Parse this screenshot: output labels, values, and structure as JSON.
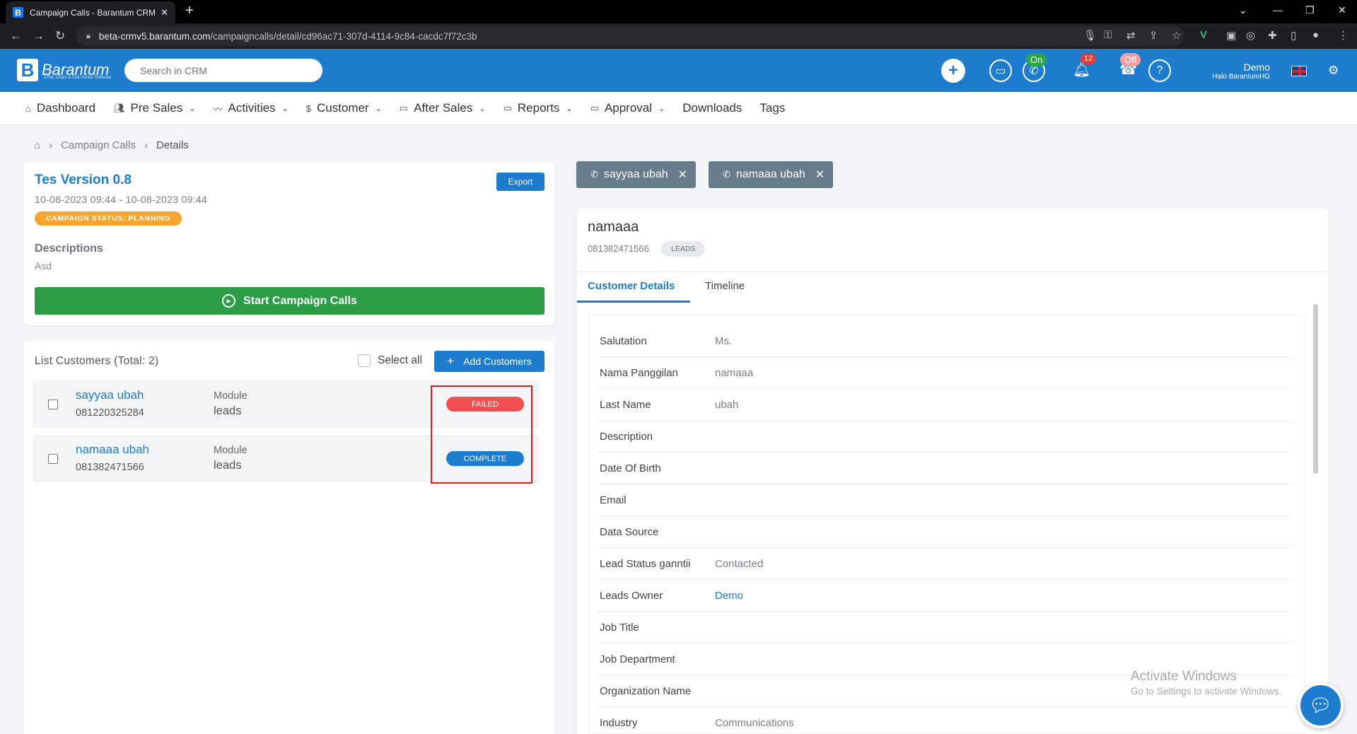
{
  "browser": {
    "tab_title": "Campaign Calls - Barantum CRM",
    "url_host": "beta-crmv5.barantum.com",
    "url_path": "/campaigncalls/detail/cd96ac71-307d-4114-9c84-cacdc7f72c3b"
  },
  "header": {
    "logo_name": "Barantum",
    "logo_tagline": "CRM, Chats & Call Center Software",
    "search_placeholder": "Search in CRM",
    "call_status": "On",
    "notification_count": "12",
    "agent_status": "Off",
    "user_name": "Demo",
    "user_greeting": "Halo BarantumHG"
  },
  "menu": [
    {
      "label": "Dashboard",
      "icon": "home-icon",
      "dropdown": false
    },
    {
      "label": "Pre Sales",
      "icon": "users-icon",
      "dropdown": true
    },
    {
      "label": "Activities",
      "icon": "activity-icon",
      "dropdown": true
    },
    {
      "label": "Customer",
      "icon": "dollar-icon",
      "dropdown": true
    },
    {
      "label": "After Sales",
      "icon": "folder-icon",
      "dropdown": true
    },
    {
      "label": "Reports",
      "icon": "folder-icon",
      "dropdown": true
    },
    {
      "label": "Approval",
      "icon": "folder-icon",
      "dropdown": true
    },
    {
      "label": "Downloads",
      "icon": "",
      "dropdown": false
    },
    {
      "label": "Tags",
      "icon": "",
      "dropdown": false
    }
  ],
  "breadcrumb": {
    "parent": "Campaign Calls",
    "current": "Details"
  },
  "campaign": {
    "title": "Tes Version 0.8",
    "date_range": "10-08-2023 09:44 - 10-08-2023 09:44",
    "status_label": "CAMPAIGN STATUS: ",
    "status_value": "PLANNING",
    "export_label": "Export",
    "descriptions_label": "Descriptions",
    "descriptions_value": "Asd",
    "start_label": "Start Campaign Calls"
  },
  "customer_list": {
    "title": "List Customers (Total: 2)",
    "select_all_label": "Select all",
    "add_label": "Add Customers",
    "rows": [
      {
        "name": "sayyaa ubah",
        "phone": "081220325284",
        "module_label": "Module",
        "module_value": "leads",
        "status": "FAILED",
        "status_color": "#f0504f"
      },
      {
        "name": "namaaa ubah",
        "phone": "081382471566",
        "module_label": "Module",
        "module_value": "leads",
        "status": "COMPLETE",
        "status_color": "#1e7ccf"
      }
    ]
  },
  "call_chips": [
    {
      "label": "sayyaa ubah"
    },
    {
      "label": "namaaa ubah"
    }
  ],
  "customer": {
    "name": "namaaa",
    "phone": "081382471566",
    "type_chip": "LEADS",
    "tabs": [
      {
        "label": "Customer Details",
        "active": true
      },
      {
        "label": "Timeline",
        "active": false
      }
    ],
    "fields": [
      {
        "label": "Salutation",
        "value": "Ms."
      },
      {
        "label": "Nama Panggilan",
        "value": "namaaa"
      },
      {
        "label": "Last Name",
        "value": "ubah"
      },
      {
        "label": "Description",
        "value": ""
      },
      {
        "label": "Date Of Birth",
        "value": ""
      },
      {
        "label": "Email",
        "value": ""
      },
      {
        "label": "Data Source",
        "value": ""
      },
      {
        "label": "Lead Status ganntii",
        "value": "Contacted"
      },
      {
        "label": "Leads Owner",
        "value": "Demo"
      },
      {
        "label": "Job Title",
        "value": ""
      },
      {
        "label": "Job Department",
        "value": ""
      },
      {
        "label": "Organization Name",
        "value": ""
      },
      {
        "label": "Industry",
        "value": "Communications"
      }
    ]
  },
  "watermark": {
    "line1": "Activate Windows",
    "line2": "Go to Settings to activate Windows."
  },
  "colors": {
    "brand": "#1e7ccf",
    "success": "#2c9d46",
    "planning": "#f7a531",
    "failed": "#f0504f"
  }
}
